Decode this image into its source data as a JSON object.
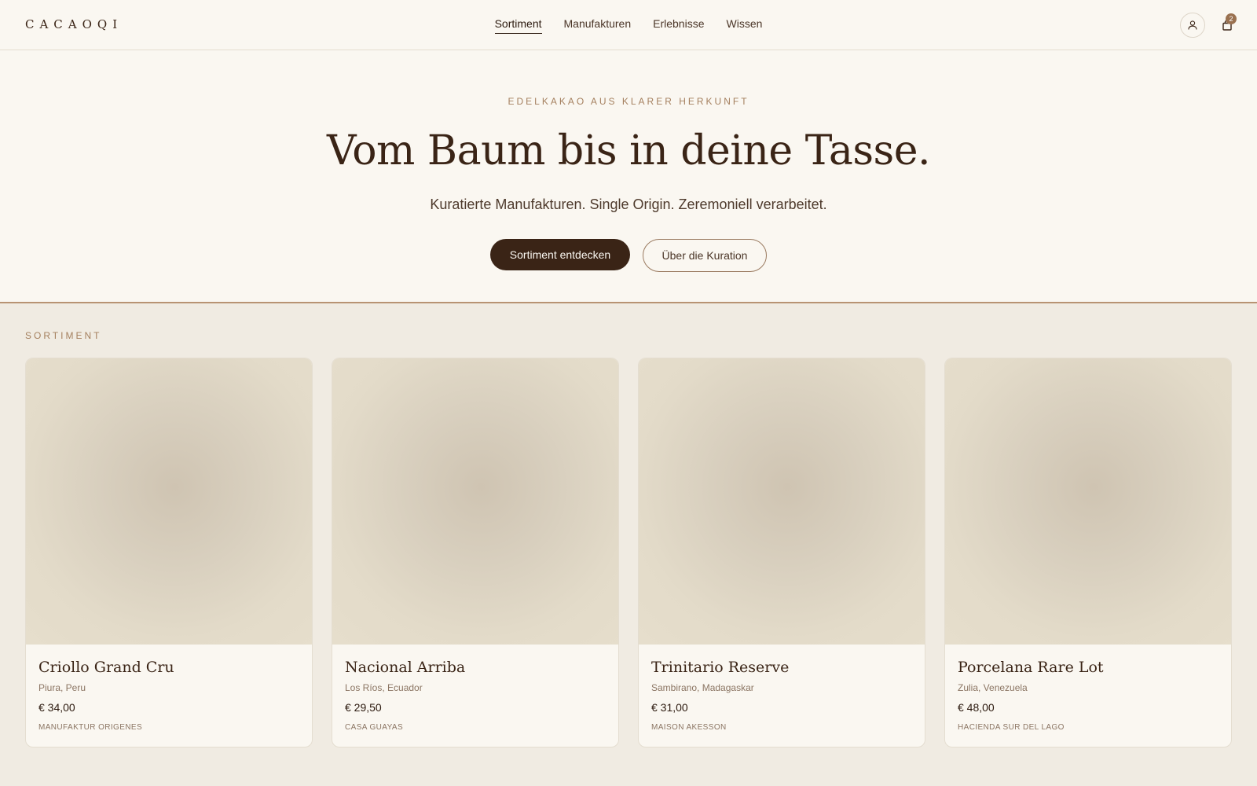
{
  "header": {
    "logo": "CACAOQI",
    "nav": [
      {
        "label": "Sortiment",
        "active": true
      },
      {
        "label": "Manufakturen",
        "active": false
      },
      {
        "label": "Erlebnisse",
        "active": false
      },
      {
        "label": "Wissen",
        "active": false
      }
    ],
    "account_icon": "user-icon",
    "cart_icon": "shopping-bag-icon",
    "cart_count": "2"
  },
  "hero": {
    "eyebrow": "EDELKAKAO AUS KLARER HERKUNFT",
    "title": "Vom Baum bis in deine Tasse.",
    "subtitle": "Kuratierte Manufakturen. Single Origin. Zeremoniell verarbeitet.",
    "primary_cta": "Sortiment entdecken",
    "secondary_cta": "Über die Kuration"
  },
  "catalogue": {
    "label": "SORTIMENT",
    "products": [
      {
        "name": "Criollo Grand Cru",
        "origin": "Piura, Peru",
        "price": "€ 34,00",
        "maker": "Manufaktur Origenes"
      },
      {
        "name": "Nacional Arriba",
        "origin": "Los Ríos, Ecuador",
        "price": "€ 29,50",
        "maker": "Casa Guayas"
      },
      {
        "name": "Trinitario Reserve",
        "origin": "Sambirano, Madagaskar",
        "price": "€ 31,00",
        "maker": "Maison Akesson"
      },
      {
        "name": "Porcelana Rare Lot",
        "origin": "Zulia, Venezuela",
        "price": "€ 48,00",
        "maker": "Hacienda Sur del Lago"
      }
    ]
  },
  "colors": {
    "background": "#faf7f1",
    "section_background": "#f0ebe2",
    "primary": "#3a2416",
    "accent": "#a5805f"
  }
}
